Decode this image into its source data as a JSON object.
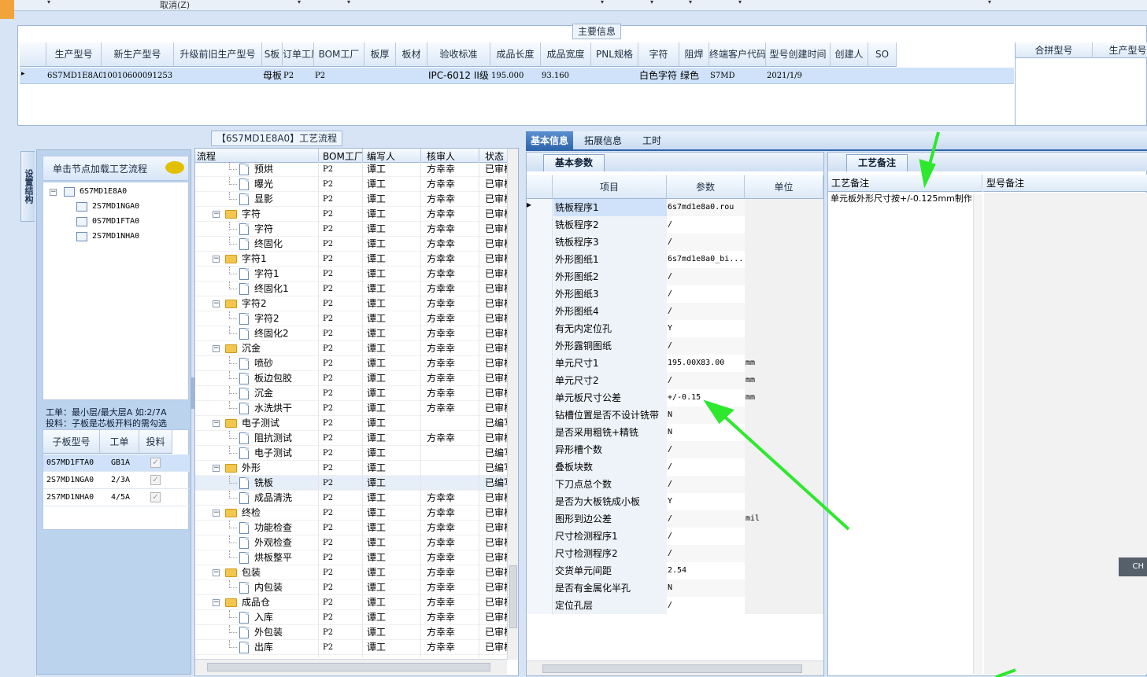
{
  "toolbar": {
    "cancel_label": "取消(Z)"
  },
  "main_info": {
    "title": "主要信息",
    "columns": [
      "生产型号",
      "新生产型号",
      "升级前旧生产型号",
      "S板",
      "订单工厂",
      "BOM工厂",
      "板厚",
      "板材",
      "验收标准",
      "成品长度",
      "成品宽度",
      "PNL规格",
      "字符",
      "阻焊",
      "终端客户代码",
      "型号创建时间",
      "创建人",
      "SO"
    ],
    "row": [
      "6S7MD1E8A0",
      "10010600091253",
      "",
      "母板",
      "P2",
      "P2",
      "",
      "",
      "IPC-6012 II级",
      "195.000",
      "93.160",
      "",
      "白色字符",
      "绿色",
      "S7MD",
      "2021/1/9",
      "",
      ""
    ],
    "merge_columns": [
      "合拼型号",
      "生产型号"
    ]
  },
  "flow_panel": {
    "title": "【6S7MD1E8A0】工艺流程"
  },
  "left": {
    "vtab": "设置结构",
    "header": "单击节点加载工艺流程",
    "tree": [
      "6S7MD1E8A0",
      "2S7MD1NGA0",
      "0S7MD1FTA0",
      "2S7MD1NHA0"
    ],
    "note1": "工单：最小层/最大层A 如:2/7A",
    "note2": "投料：子板是芯板开料的需勾选",
    "sub_table": {
      "headers": [
        "子板型号",
        "工单",
        "投料"
      ],
      "rows": [
        [
          "0S7MD1FTA0",
          "GB1A"
        ],
        [
          "2S7MD1NGA0",
          "2/3A"
        ],
        [
          "2S7MD1NHA0",
          "4/5A"
        ]
      ]
    }
  },
  "process": {
    "headers": [
      "流程",
      "BOM工厂",
      "编写人",
      "核审人",
      "状态"
    ],
    "rows": [
      {
        "t": "d",
        "n": "预烘",
        "f": "P2",
        "w": "谭工",
        "r": "方幸幸",
        "s": "已审核"
      },
      {
        "t": "d",
        "n": "曝光",
        "f": "P2",
        "w": "谭工",
        "r": "方幸幸",
        "s": "已审核"
      },
      {
        "t": "d",
        "n": "显影",
        "f": "P2",
        "w": "谭工",
        "r": "方幸幸",
        "s": "已审核"
      },
      {
        "t": "f",
        "n": "字符",
        "f": "P2",
        "w": "谭工",
        "r": "方幸幸",
        "s": "已审核"
      },
      {
        "t": "d",
        "n": "字符",
        "f": "P2",
        "w": "谭工",
        "r": "方幸幸",
        "s": "已审核"
      },
      {
        "t": "d",
        "n": "终固化",
        "f": "P2",
        "w": "谭工",
        "r": "方幸幸",
        "s": "已审核"
      },
      {
        "t": "f",
        "n": "字符1",
        "f": "P2",
        "w": "谭工",
        "r": "方幸幸",
        "s": "已审核"
      },
      {
        "t": "d",
        "n": "字符1",
        "f": "P2",
        "w": "谭工",
        "r": "方幸幸",
        "s": "已审核"
      },
      {
        "t": "d",
        "n": "终固化1",
        "f": "P2",
        "w": "谭工",
        "r": "方幸幸",
        "s": "已审核"
      },
      {
        "t": "f",
        "n": "字符2",
        "f": "P2",
        "w": "谭工",
        "r": "方幸幸",
        "s": "已审核"
      },
      {
        "t": "d",
        "n": "字符2",
        "f": "P2",
        "w": "谭工",
        "r": "方幸幸",
        "s": "已审核"
      },
      {
        "t": "d",
        "n": "终固化2",
        "f": "P2",
        "w": "谭工",
        "r": "方幸幸",
        "s": "已审核"
      },
      {
        "t": "f",
        "n": "沉金",
        "f": "P2",
        "w": "谭工",
        "r": "方幸幸",
        "s": "已审核"
      },
      {
        "t": "d",
        "n": "喷砂",
        "f": "P2",
        "w": "谭工",
        "r": "方幸幸",
        "s": "已审核"
      },
      {
        "t": "d",
        "n": "板边包胶",
        "f": "P2",
        "w": "谭工",
        "r": "方幸幸",
        "s": "已审核"
      },
      {
        "t": "d",
        "n": "沉金",
        "f": "P2",
        "w": "谭工",
        "r": "方幸幸",
        "s": "已审核"
      },
      {
        "t": "d",
        "n": "水洗烘干",
        "f": "P2",
        "w": "谭工",
        "r": "方幸幸",
        "s": "已审核"
      },
      {
        "t": "f",
        "n": "电子测试",
        "f": "P2",
        "w": "谭工",
        "r": "",
        "s": "已编写"
      },
      {
        "t": "d",
        "n": "阻抗测试",
        "f": "P2",
        "w": "谭工",
        "r": "方幸幸",
        "s": "已审核"
      },
      {
        "t": "d",
        "n": "电子测试",
        "f": "P2",
        "w": "谭工",
        "r": "",
        "s": "已编写"
      },
      {
        "t": "f",
        "n": "外形",
        "f": "P2",
        "w": "谭工",
        "r": "",
        "s": "已编写"
      },
      {
        "t": "d",
        "n": "铣板",
        "f": "P2",
        "w": "谭工",
        "r": "",
        "s": "已编写",
        "sel": true
      },
      {
        "t": "d",
        "n": "成品清洗",
        "f": "P2",
        "w": "谭工",
        "r": "方幸幸",
        "s": "已审核"
      },
      {
        "t": "f",
        "n": "终检",
        "f": "P2",
        "w": "谭工",
        "r": "方幸幸",
        "s": "已审核"
      },
      {
        "t": "d",
        "n": "功能检查",
        "f": "P2",
        "w": "谭工",
        "r": "方幸幸",
        "s": "已审核"
      },
      {
        "t": "d",
        "n": "外观检查",
        "f": "P2",
        "w": "谭工",
        "r": "方幸幸",
        "s": "已审核"
      },
      {
        "t": "d",
        "n": "烘板整平",
        "f": "P2",
        "w": "谭工",
        "r": "方幸幸",
        "s": "已审核"
      },
      {
        "t": "f",
        "n": "包装",
        "f": "P2",
        "w": "谭工",
        "r": "方幸幸",
        "s": "已审核"
      },
      {
        "t": "d",
        "n": "内包装",
        "f": "P2",
        "w": "谭工",
        "r": "方幸幸",
        "s": "已审核"
      },
      {
        "t": "f",
        "n": "成品仓",
        "f": "P2",
        "w": "谭工",
        "r": "方幸幸",
        "s": "已审核"
      },
      {
        "t": "d",
        "n": "入库",
        "f": "P2",
        "w": "谭工",
        "r": "方幸幸",
        "s": "已审核"
      },
      {
        "t": "d",
        "n": "外包装",
        "f": "P2",
        "w": "谭工",
        "r": "方幸幸",
        "s": "已审核"
      },
      {
        "t": "d",
        "n": "出库",
        "f": "P2",
        "w": "谭工",
        "r": "方幸幸",
        "s": "已审核"
      }
    ]
  },
  "detail_tabs": [
    "基本信息",
    "拓展信息",
    "工时"
  ],
  "params": {
    "tab": "基本参数",
    "headers": [
      "项目",
      "参数",
      "单位"
    ],
    "rows": [
      [
        "铣板程序1",
        "6s7md1e8a0.rou",
        ""
      ],
      [
        "铣板程序2",
        "/",
        ""
      ],
      [
        "铣板程序3",
        "/",
        ""
      ],
      [
        "外形图纸1",
        "6s7md1e8a0_bi...",
        ""
      ],
      [
        "外形图纸2",
        "/",
        ""
      ],
      [
        "外形图纸3",
        "/",
        ""
      ],
      [
        "外形图纸4",
        "/",
        ""
      ],
      [
        "有无内定位孔",
        "Y",
        ""
      ],
      [
        "外形露铜图纸",
        "/",
        ""
      ],
      [
        "单元尺寸1",
        "195.00X83.00",
        "mm"
      ],
      [
        "单元尺寸2",
        "/",
        "mm"
      ],
      [
        "单元板尺寸公差",
        "+/-0.15",
        "mm"
      ],
      [
        "钻槽位置是否不设计铣带",
        "N",
        ""
      ],
      [
        "是否采用粗铣+精铣",
        "N",
        ""
      ],
      [
        "异形槽个数",
        "/",
        ""
      ],
      [
        "叠板块数",
        "/",
        ""
      ],
      [
        "下刀点总个数",
        "/",
        ""
      ],
      [
        "是否为大板铣成小板",
        "Y",
        ""
      ],
      [
        "图形到边公差",
        "/",
        "mil"
      ],
      [
        "尺寸检测程序1",
        "/",
        ""
      ],
      [
        "尺寸检测程序2",
        "/",
        ""
      ],
      [
        "交货单元间距",
        "2.54",
        ""
      ],
      [
        "是否有金属化半孔",
        "N",
        ""
      ],
      [
        "定位孔层",
        "/",
        ""
      ]
    ]
  },
  "remarks": {
    "tab": "工艺备注",
    "col1": "工艺备注",
    "col2": "型号备注",
    "text": "单元板外形尺寸按+/-0.125mm制作"
  },
  "ime_badge": "CH",
  "colors": {
    "arrow": "#2ee82e",
    "selected_row": "#cfe2fa",
    "tab_active": "#2e65ab"
  }
}
